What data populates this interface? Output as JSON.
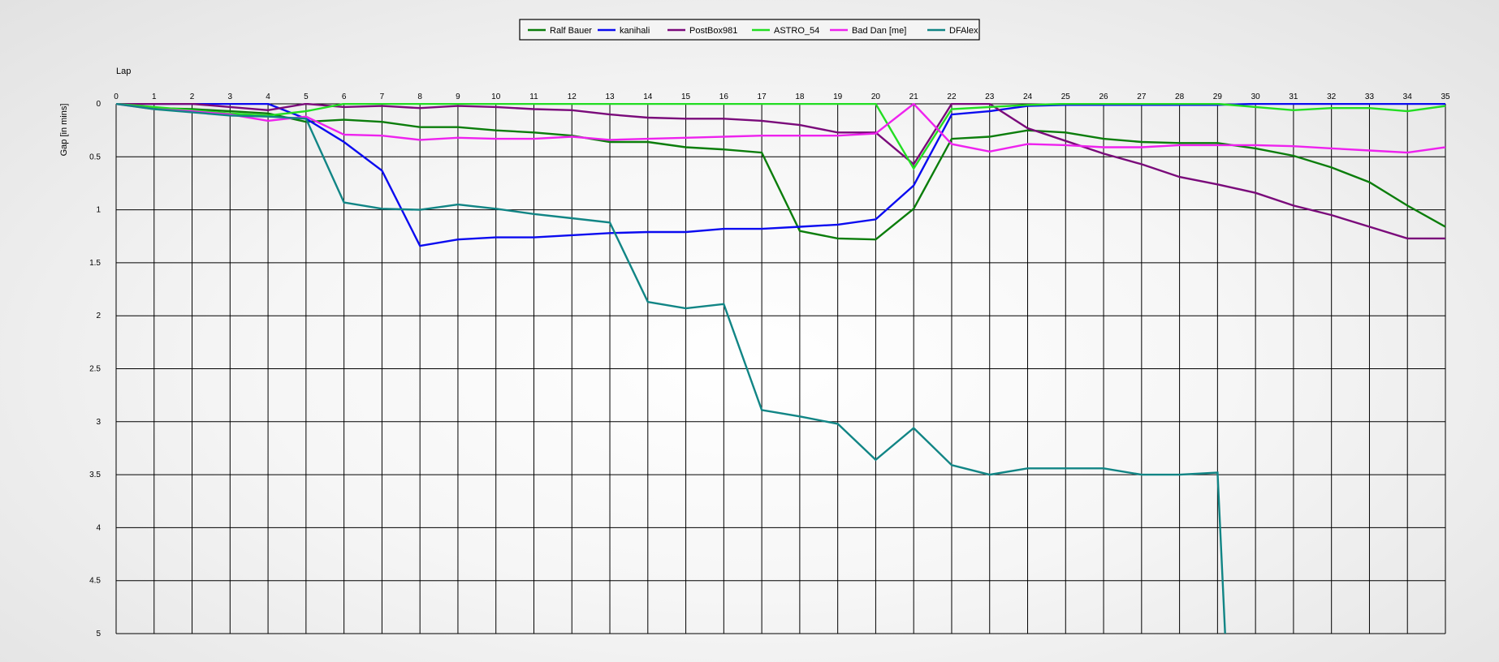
{
  "chart_data": {
    "type": "line",
    "xlabel": "Lap",
    "ylabel": "Gap [in mins]",
    "xlim": [
      0,
      35
    ],
    "ylim": [
      0,
      5
    ],
    "y_inverted": true,
    "grid": true,
    "legend_position": "top-center",
    "x_ticks": [
      0,
      1,
      2,
      3,
      4,
      5,
      6,
      7,
      8,
      9,
      10,
      11,
      12,
      13,
      14,
      15,
      16,
      17,
      18,
      19,
      20,
      21,
      22,
      23,
      24,
      25,
      26,
      27,
      28,
      29,
      30,
      31,
      32,
      33,
      34,
      35
    ],
    "y_ticks": [
      0,
      0.5,
      1,
      1.5,
      2,
      2.5,
      3,
      3.5,
      4,
      4.5,
      5
    ],
    "series": [
      {
        "name": "Ralf Bauer",
        "color": "#0b7d0b",
        "points": [
          [
            0,
            0
          ],
          [
            1,
            0.04
          ],
          [
            2,
            0.05
          ],
          [
            3,
            0.07
          ],
          [
            4,
            0.09
          ],
          [
            5,
            0.17
          ],
          [
            6,
            0.15
          ],
          [
            7,
            0.17
          ],
          [
            8,
            0.22
          ],
          [
            9,
            0.22
          ],
          [
            10,
            0.25
          ],
          [
            11,
            0.27
          ],
          [
            12,
            0.3
          ],
          [
            13,
            0.36
          ],
          [
            14,
            0.36
          ],
          [
            15,
            0.41
          ],
          [
            16,
            0.43
          ],
          [
            17,
            0.46
          ],
          [
            18,
            1.2
          ],
          [
            19,
            1.27
          ],
          [
            20,
            1.28
          ],
          [
            21,
            0.99
          ],
          [
            22,
            0.33
          ],
          [
            23,
            0.31
          ],
          [
            24,
            0.25
          ],
          [
            25,
            0.27
          ],
          [
            26,
            0.33
          ],
          [
            27,
            0.36
          ],
          [
            28,
            0.37
          ],
          [
            29,
            0.37
          ],
          [
            30,
            0.42
          ],
          [
            31,
            0.49
          ],
          [
            32,
            0.6
          ],
          [
            33,
            0.74
          ],
          [
            34,
            0.96
          ],
          [
            35,
            1.16
          ]
        ]
      },
      {
        "name": "kanihali",
        "color": "#0b0bf0",
        "points": [
          [
            0,
            0
          ],
          [
            1,
            0
          ],
          [
            2,
            0
          ],
          [
            3,
            0
          ],
          [
            4,
            0
          ],
          [
            5,
            0.14
          ],
          [
            6,
            0.36
          ],
          [
            7,
            0.63
          ],
          [
            8,
            1.34
          ],
          [
            9,
            1.28
          ],
          [
            10,
            1.26
          ],
          [
            11,
            1.26
          ],
          [
            12,
            1.24
          ],
          [
            13,
            1.22
          ],
          [
            14,
            1.21
          ],
          [
            15,
            1.21
          ],
          [
            16,
            1.18
          ],
          [
            17,
            1.18
          ],
          [
            18,
            1.16
          ],
          [
            19,
            1.14
          ],
          [
            20,
            1.09
          ],
          [
            21,
            0.77
          ],
          [
            22,
            0.1
          ],
          [
            23,
            0.07
          ],
          [
            24,
            0.02
          ],
          [
            25,
            0.01
          ],
          [
            26,
            0.01
          ],
          [
            27,
            0.01
          ],
          [
            28,
            0.01
          ],
          [
            29,
            0.01
          ],
          [
            30,
            0
          ],
          [
            31,
            0
          ],
          [
            32,
            0
          ],
          [
            33,
            0
          ],
          [
            34,
            0
          ],
          [
            35,
            0
          ]
        ]
      },
      {
        "name": "PostBox981",
        "color": "#7a0a7a",
        "points": [
          [
            0,
            0
          ],
          [
            1,
            0
          ],
          [
            2,
            0
          ],
          [
            3,
            0.03
          ],
          [
            4,
            0.06
          ],
          [
            5,
            0
          ],
          [
            6,
            0.03
          ],
          [
            7,
            0.02
          ],
          [
            8,
            0.04
          ],
          [
            9,
            0.02
          ],
          [
            10,
            0.03
          ],
          [
            11,
            0.05
          ],
          [
            12,
            0.06
          ],
          [
            13,
            0.1
          ],
          [
            14,
            0.13
          ],
          [
            15,
            0.14
          ],
          [
            16,
            0.14
          ],
          [
            17,
            0.16
          ],
          [
            18,
            0.2
          ],
          [
            19,
            0.27
          ],
          [
            20,
            0.27
          ],
          [
            21,
            0.57
          ],
          [
            22,
            0
          ],
          [
            23,
            0
          ],
          [
            24,
            0.23
          ],
          [
            25,
            0.35
          ],
          [
            26,
            0.47
          ],
          [
            27,
            0.57
          ],
          [
            28,
            0.69
          ],
          [
            29,
            0.76
          ],
          [
            30,
            0.84
          ],
          [
            31,
            0.96
          ],
          [
            32,
            1.05
          ],
          [
            33,
            1.16
          ],
          [
            34,
            1.27
          ],
          [
            35,
            1.27
          ]
        ]
      },
      {
        "name": "ASTRO_54",
        "color": "#22dd22",
        "points": [
          [
            0,
            0
          ],
          [
            1,
            0.03
          ],
          [
            2,
            0.06
          ],
          [
            3,
            0.09
          ],
          [
            4,
            0.11
          ],
          [
            5,
            0.07
          ],
          [
            6,
            0
          ],
          [
            7,
            0
          ],
          [
            8,
            0
          ],
          [
            9,
            0
          ],
          [
            10,
            0
          ],
          [
            11,
            0
          ],
          [
            12,
            0
          ],
          [
            13,
            0
          ],
          [
            14,
            0
          ],
          [
            15,
            0
          ],
          [
            16,
            0
          ],
          [
            17,
            0
          ],
          [
            18,
            0
          ],
          [
            19,
            0
          ],
          [
            20,
            0
          ],
          [
            21,
            0.61
          ],
          [
            22,
            0.05
          ],
          [
            23,
            0.03
          ],
          [
            24,
            0.01
          ],
          [
            25,
            0
          ],
          [
            26,
            0
          ],
          [
            27,
            0
          ],
          [
            28,
            0
          ],
          [
            29,
            0
          ],
          [
            30,
            0.03
          ],
          [
            31,
            0.06
          ],
          [
            32,
            0.04
          ],
          [
            33,
            0.04
          ],
          [
            34,
            0.07
          ],
          [
            35,
            0.02
          ]
        ]
      },
      {
        "name": "Bad Dan [me]",
        "color": "#ee22ee",
        "points": [
          [
            0,
            0
          ],
          [
            1,
            0.05
          ],
          [
            2,
            0.07
          ],
          [
            3,
            0.1
          ],
          [
            4,
            0.16
          ],
          [
            5,
            0.12
          ],
          [
            6,
            0.29
          ],
          [
            7,
            0.3
          ],
          [
            8,
            0.34
          ],
          [
            9,
            0.32
          ],
          [
            10,
            0.33
          ],
          [
            11,
            0.33
          ],
          [
            12,
            0.31
          ],
          [
            13,
            0.34
          ],
          [
            14,
            0.33
          ],
          [
            15,
            0.32
          ],
          [
            16,
            0.31
          ],
          [
            17,
            0.3
          ],
          [
            18,
            0.3
          ],
          [
            19,
            0.3
          ],
          [
            20,
            0.28
          ],
          [
            21,
            0
          ],
          [
            22,
            0.38
          ],
          [
            23,
            0.45
          ],
          [
            24,
            0.38
          ],
          [
            25,
            0.39
          ],
          [
            26,
            0.41
          ],
          [
            27,
            0.41
          ],
          [
            28,
            0.39
          ],
          [
            29,
            0.39
          ],
          [
            30,
            0.39
          ],
          [
            31,
            0.4
          ],
          [
            32,
            0.42
          ],
          [
            33,
            0.44
          ],
          [
            34,
            0.46
          ],
          [
            35,
            0.41
          ]
        ]
      },
      {
        "name": "DFAlex",
        "color": "#118585",
        "points": [
          [
            0,
            0
          ],
          [
            1,
            0.05
          ],
          [
            2,
            0.08
          ],
          [
            3,
            0.11
          ],
          [
            4,
            0.12
          ],
          [
            5,
            0.14
          ],
          [
            6,
            0.93
          ],
          [
            7,
            0.99
          ],
          [
            8,
            1.0
          ],
          [
            9,
            0.95
          ],
          [
            10,
            0.99
          ],
          [
            11,
            1.04
          ],
          [
            12,
            1.08
          ],
          [
            13,
            1.12
          ],
          [
            14,
            1.87
          ],
          [
            15,
            1.93
          ],
          [
            16,
            1.89
          ],
          [
            17,
            2.89
          ],
          [
            18,
            2.95
          ],
          [
            19,
            3.02
          ],
          [
            20,
            3.36
          ],
          [
            21,
            3.06
          ],
          [
            22,
            3.41
          ],
          [
            23,
            3.5
          ],
          [
            24,
            3.44
          ],
          [
            25,
            3.44
          ],
          [
            26,
            3.44
          ],
          [
            27,
            3.5
          ],
          [
            28,
            3.5
          ],
          [
            29,
            3.48
          ],
          [
            29.2,
            5
          ]
        ]
      }
    ]
  }
}
